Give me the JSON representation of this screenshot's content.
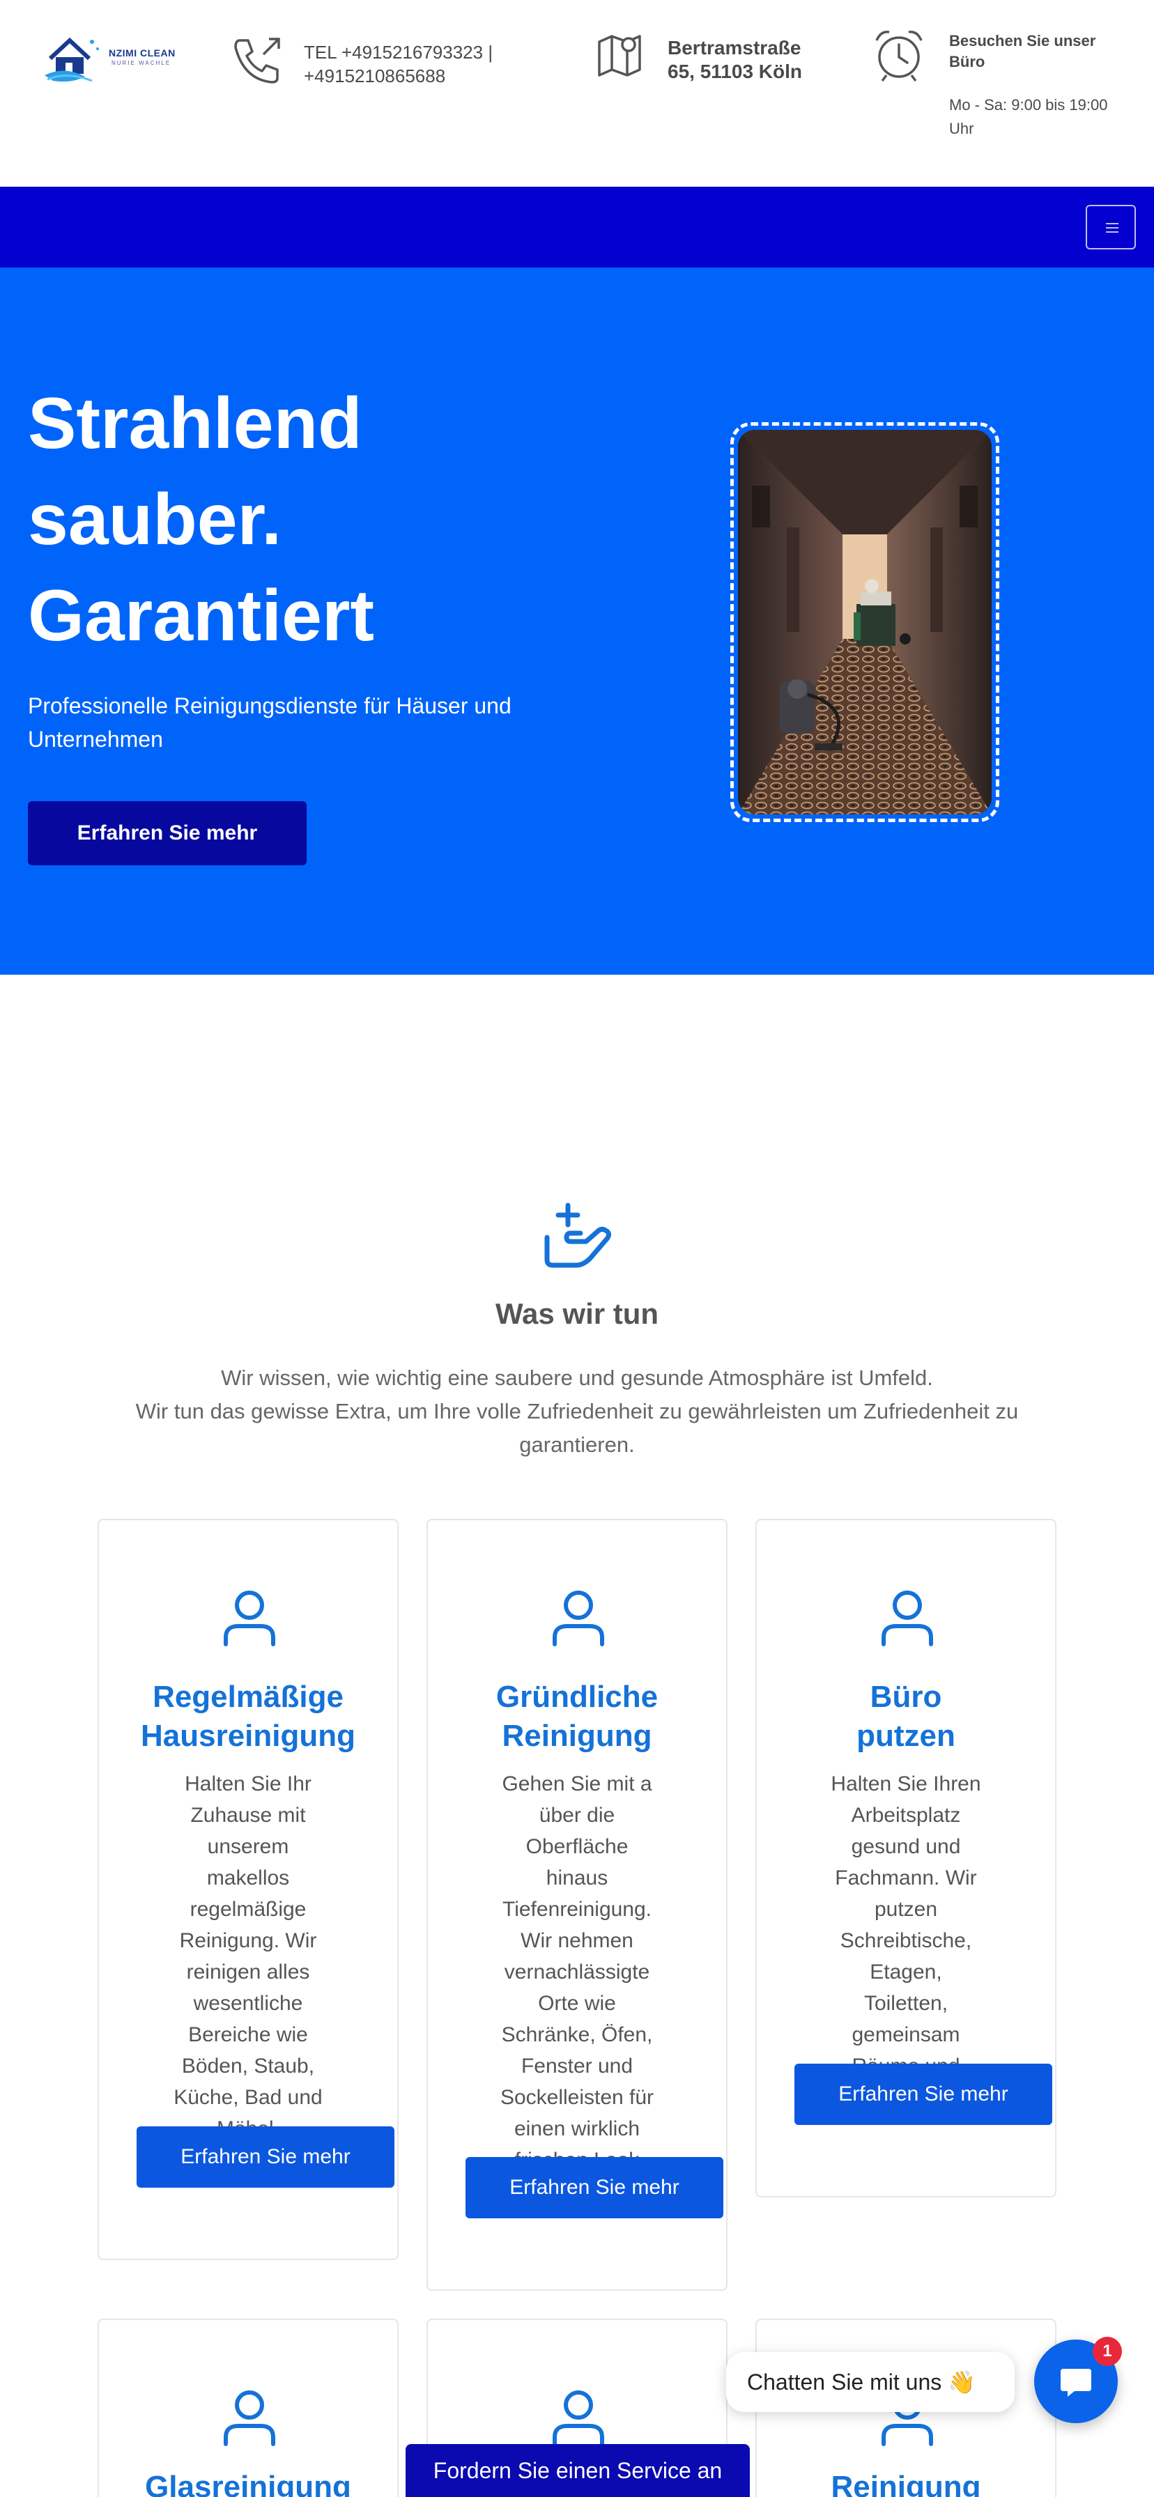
{
  "header": {
    "logo": {
      "brand": "NZIMI CLEAN",
      "tagline": "NURIE WACHLE"
    },
    "phone": {
      "line1": "TEL +4915216793323 |",
      "line2": "+4915210865688"
    },
    "address": {
      "line1": "Bertramstraße",
      "line2": "65, 51103 Köln"
    },
    "office": {
      "line1": "Besuchen Sie unser",
      "line2": "Büro",
      "hours1": "Mo - Sa: 9:00 bis 19:00",
      "hours2": "Uhr"
    }
  },
  "hero": {
    "title_lines": [
      "Strahlend",
      "sauber.",
      "Garantiert"
    ],
    "subtitle": "Professionelle Reinigungsdienste für Häuser und Unternehmen",
    "button": "Erfahren Sie mehr"
  },
  "services": {
    "title": "Was wir tun",
    "desc1": "Wir wissen, wie wichtig eine saubere und gesunde Atmosphäre ist Umfeld.",
    "desc2": "Wir tun das gewisse Extra, um Ihre volle Zufriedenheit zu gewährleisten um Zufriedenheit zu garantieren.",
    "cards": [
      {
        "title1": "Regelmäßige",
        "title2": "Hausreinigung",
        "text": "Halten Sie Ihr Zuhause mit unserem makellos regelmäßige Reinigung. Wir reinigen alles wesentliche Bereiche wie Böden, Staub, Küche, Bad und Möbel.",
        "button": "Erfahren Sie mehr"
      },
      {
        "title1": "Gründliche",
        "title2": "Reinigung",
        "text": "Gehen Sie mit a über die Oberfläche hinaus Tiefenreinigung. Wir nehmen vernachlässigte Orte wie Schränke, Öfen, Fenster und Sockelleisten für einen wirklich frischen Look Zimmer.",
        "button": "Erfahren Sie mehr"
      },
      {
        "title1": "Büro",
        "title2": "putzen",
        "text": "Halten Sie Ihren Arbeitsplatz gesund und Fachmann. Wir putzen Schreibtische, Etagen, Toiletten, gemeinsam Räume und mehr.",
        "button": "Erfahren Sie mehr"
      }
    ],
    "cards_row2": [
      {
        "title": "Glasreinigung"
      },
      {
        "title": ""
      },
      {
        "title": "Reinigung"
      }
    ]
  },
  "chat": {
    "bubble": "Chatten Sie mit uns 👋",
    "badge": "1"
  },
  "service_bar": "Fordern Sie einen Service an",
  "colors": {
    "nav": "#0300d0",
    "hero": "#0064fa",
    "accent": "#1472d8",
    "button": "#0b57e0",
    "hero_button": "#07099e"
  }
}
